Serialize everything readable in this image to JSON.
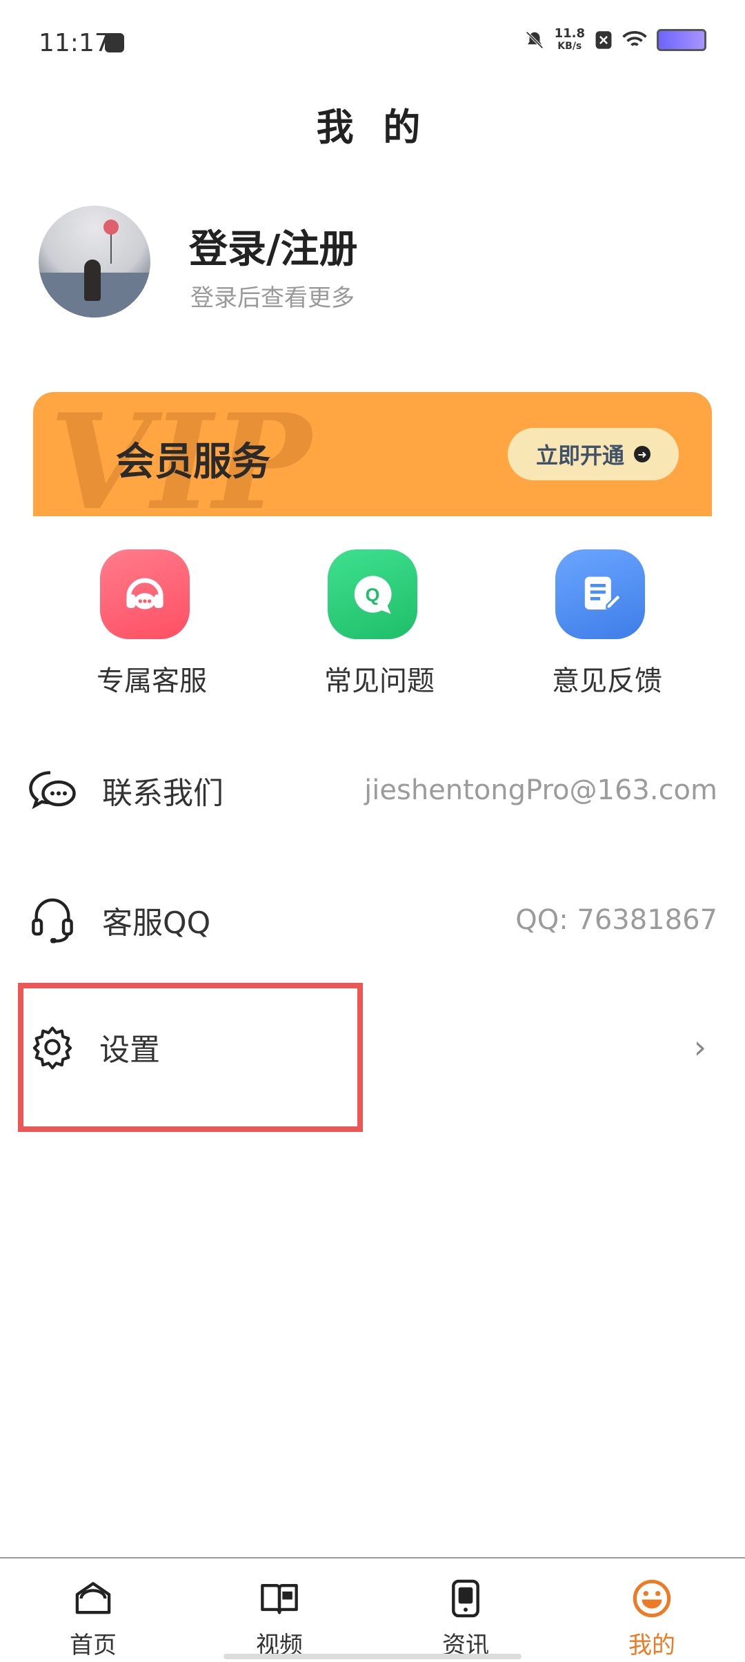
{
  "status_bar": {
    "time": "11:17",
    "net_speed_value": "11.8",
    "net_speed_unit": "KB/s"
  },
  "header": {
    "title": "我 的"
  },
  "profile": {
    "title": "登录/注册",
    "subtitle": "登录后查看更多"
  },
  "vip": {
    "watermark": "VIP",
    "title": "会员服务",
    "button_label": "立即开通"
  },
  "services": [
    {
      "label": "专属客服",
      "icon": "headset-icon",
      "color": "#ff5c6e"
    },
    {
      "label": "常见问题",
      "icon": "question-chat-icon",
      "color": "#28d07a"
    },
    {
      "label": "意见反馈",
      "icon": "edit-note-icon",
      "color": "#4a8ef7"
    }
  ],
  "rows": {
    "contact": {
      "label": "联系我们",
      "value": "jieshentongPro@163.com",
      "icon": "chat-bubble-icon"
    },
    "qq": {
      "label": "客服QQ",
      "value": "QQ: 76381867",
      "icon": "headphones-icon"
    },
    "settings": {
      "label": "设置",
      "icon": "gear-icon"
    }
  },
  "bottom_nav": {
    "items": [
      {
        "label": "首页",
        "icon": "home-icon"
      },
      {
        "label": "视频",
        "icon": "book-icon"
      },
      {
        "label": "资讯",
        "icon": "tablet-icon"
      },
      {
        "label": "我的",
        "icon": "smile-icon",
        "active": true
      }
    ],
    "active_color": "#ee7a24"
  }
}
